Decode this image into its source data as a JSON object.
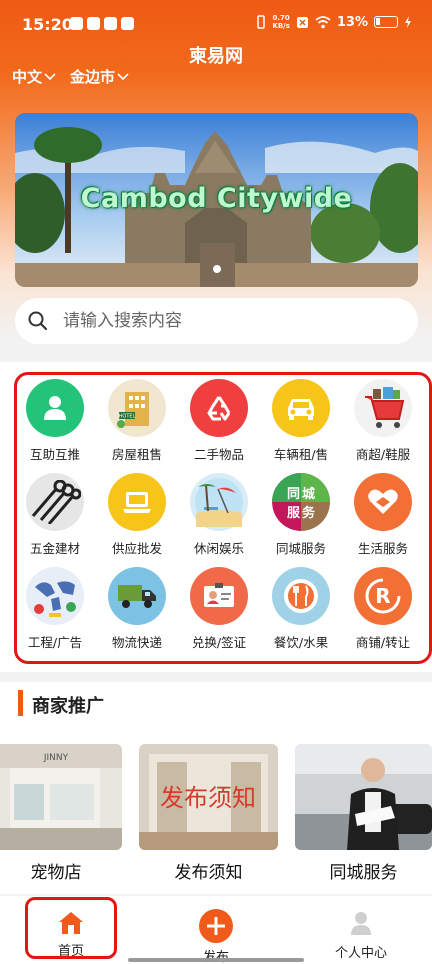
{
  "status_bar": {
    "time": "15:20",
    "network_speed_value": "0.70",
    "network_speed_unit": "KB/s",
    "battery": "13%"
  },
  "header": {
    "title": "柬易网",
    "language": "中文",
    "city": "金边市"
  },
  "banner": {
    "caption": "Cambod Citywide",
    "slide_index": 1,
    "slide_count": 1
  },
  "search": {
    "placeholder": "请输入搜索内容"
  },
  "categories": [
    {
      "label": "互助互推",
      "icon": "person-icon",
      "color": "#23c47a"
    },
    {
      "label": "房屋租售",
      "icon": "hotel-building-icon",
      "color": "#f1e6cf"
    },
    {
      "label": "二手物品",
      "icon": "recycle-icon",
      "color": "#ef3f3f"
    },
    {
      "label": "车辆租/售",
      "icon": "car-icon",
      "color": "#f7c51a"
    },
    {
      "label": "商超/鞋服",
      "icon": "shopping-cart-icon",
      "color": "#f2f2f2"
    },
    {
      "label": "五金建材",
      "icon": "pipes-icon",
      "color": "#e6e6e6"
    },
    {
      "label": "供应批发",
      "icon": "laptop-icon",
      "color": "#f7c51a"
    },
    {
      "label": "休闲娱乐",
      "icon": "beach-icon",
      "color": "#d7ecf7"
    },
    {
      "label": "同城服务",
      "icon": "city-service-icon",
      "color": "#3aa655"
    },
    {
      "label": "生活服务",
      "icon": "heart-hand-icon",
      "color": "#f26f35"
    },
    {
      "label": "工程/广告",
      "icon": "world-map-icon",
      "color": "#e8eef7"
    },
    {
      "label": "物流快递",
      "icon": "truck-icon",
      "color": "#7cc3e3"
    },
    {
      "label": "兑换/签证",
      "icon": "id-card-icon",
      "color": "#f06a4a"
    },
    {
      "label": "餐饮/水果",
      "icon": "cutlery-icon",
      "color": "#9fd2e6"
    },
    {
      "label": "商铺/转让",
      "icon": "shop-r-icon",
      "color": "#f26f35"
    }
  ],
  "merchants": {
    "title": "商家推广",
    "items": [
      {
        "label": "宠物店",
        "image_text": "JINNY"
      },
      {
        "label": "发布须知",
        "image_text": "发布须知"
      },
      {
        "label": "同城服务",
        "image_text": ""
      }
    ]
  },
  "bottom_nav": {
    "items": [
      {
        "label": "首页",
        "icon": "home-icon",
        "active": true
      },
      {
        "label": "发布",
        "icon": "plus-icon",
        "active": false
      },
      {
        "label": "个人中心",
        "icon": "user-icon",
        "active": false
      }
    ]
  },
  "colors": {
    "brand": "#ef5a14",
    "highlight_frame": "#e21616"
  }
}
